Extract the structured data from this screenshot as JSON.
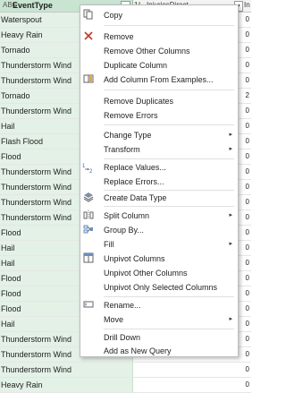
{
  "columns": {
    "col1": {
      "label": "EventType",
      "type_icon": "ABC",
      "dropdown": "▾"
    },
    "col2": {
      "label": "InjuriesDirect",
      "type_icon": "1²₃",
      "dropdown": "▾"
    },
    "col3": {
      "label": "In"
    }
  },
  "rows": [
    {
      "event": "Waterspout",
      "val": "0"
    },
    {
      "event": "Heavy Rain",
      "val": "0"
    },
    {
      "event": "Tornado",
      "val": "0"
    },
    {
      "event": "Thunderstorm Wind",
      "val": "0"
    },
    {
      "event": "Thunderstorm Wind",
      "val": "0"
    },
    {
      "event": "Tornado",
      "val": "2"
    },
    {
      "event": "Thunderstorm Wind",
      "val": "0"
    },
    {
      "event": "Hail",
      "val": "0"
    },
    {
      "event": "Flash Flood",
      "val": "0"
    },
    {
      "event": "Flood",
      "val": "0"
    },
    {
      "event": "Thunderstorm Wind",
      "val": "0"
    },
    {
      "event": "Thunderstorm Wind",
      "val": "0"
    },
    {
      "event": "Thunderstorm Wind",
      "val": "0"
    },
    {
      "event": "Thunderstorm Wind",
      "val": "0"
    },
    {
      "event": "Flood",
      "val": "0"
    },
    {
      "event": "Hail",
      "val": "0"
    },
    {
      "event": "Hail",
      "val": "0"
    },
    {
      "event": "Flood",
      "val": "0"
    },
    {
      "event": "Flood",
      "val": "0"
    },
    {
      "event": "Flood",
      "val": "0"
    },
    {
      "event": "Hail",
      "val": "0"
    },
    {
      "event": "Thunderstorm Wind",
      "val": "0"
    },
    {
      "event": "Thunderstorm Wind",
      "val": "0"
    },
    {
      "event": "Thunderstorm Wind",
      "val": "0"
    },
    {
      "event": "Heavy Rain",
      "val": "0"
    }
  ],
  "menu": {
    "copy": "Copy",
    "remove": "Remove",
    "remove_other_columns": "Remove Other Columns",
    "duplicate_column": "Duplicate Column",
    "add_column_from_examples": "Add Column From Examples...",
    "remove_duplicates": "Remove Duplicates",
    "remove_errors": "Remove Errors",
    "change_type": "Change Type",
    "transform": "Transform",
    "replace_values": "Replace Values...",
    "replace_errors": "Replace Errors...",
    "create_data_type": "Create Data Type",
    "split_column": "Split Column",
    "group_by": "Group By...",
    "fill": "Fill",
    "unpivot_columns": "Unpivot Columns",
    "unpivot_other_columns": "Unpivot Other Columns",
    "unpivot_only_selected_columns": "Unpivot Only Selected Columns",
    "rename": "Rename...",
    "move": "Move",
    "drill_down": "Drill Down",
    "add_as_new_query": "Add as New Query",
    "submenu_arrow": "▸"
  }
}
